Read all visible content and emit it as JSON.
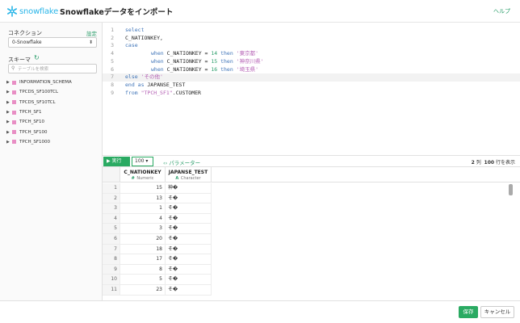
{
  "header": {
    "logo_text": "snowflake",
    "title": "Snowflakeデータをインポート",
    "help_label": "ヘルプ"
  },
  "sidebar": {
    "connection_label": "コネクション",
    "settings_label": "設定",
    "connection_value": "0-Snowflake",
    "schema_label": "スキーマ",
    "search_placeholder": "テーブルを検索",
    "schemas": [
      "INFORMATION_SCHEMA",
      "TPCDS_SF100TCL",
      "TPCDS_SF10TCL",
      "TPCH_SF1",
      "TPCH_SF10",
      "TPCH_SF100",
      "TPCH_SF1000"
    ]
  },
  "editor": {
    "line_numbers": [
      "1",
      "2",
      "3",
      "4",
      "5",
      "6",
      "7",
      "8",
      "9"
    ],
    "lines": {
      "l1": "select",
      "l2": "C_NATIONKEY,",
      "l3": "case",
      "l4_when": "when",
      "l4_col": " C_NATIONKEY = ",
      "l4_num": "14",
      "l4_then": " then ",
      "l4_str": "'東京都'",
      "l5_when": "when",
      "l5_col": " C_NATIONKEY = ",
      "l5_num": "15",
      "l5_then": " then ",
      "l5_str": "'神奈川県'",
      "l6_when": "when",
      "l6_col": " C_NATIONKEY = ",
      "l6_num": "16",
      "l6_then": " then ",
      "l6_str": "'埼玉県'",
      "l7_else": "else ",
      "l7_str": "'その他'",
      "l8_end": "end as",
      "l8_alias": " JAPANSE_TEST",
      "l9_from": "from ",
      "l9_str": "\"TPCH_SF1\"",
      "l9_rest": ".CUSTOMER"
    }
  },
  "toolbar": {
    "run_label": "実行",
    "limit_value": "100",
    "params_label": "パラメーター",
    "columns_count": "2",
    "columns_unit": "列",
    "rows_count": "100",
    "rows_unit": "行を表示"
  },
  "results": {
    "columns": [
      {
        "name": "C_NATIONKEY",
        "type_tag": "#",
        "type": "Numeric"
      },
      {
        "name": "JAPANSE_TEST",
        "type_tag": "A",
        "type": "Character"
      }
    ],
    "rows": [
      {
        "i": "1",
        "key": "15",
        "val": "神�"
      },
      {
        "i": "2",
        "key": "13",
        "val": "そ�"
      },
      {
        "i": "3",
        "key": "1",
        "val": "そ�"
      },
      {
        "i": "4",
        "key": "4",
        "val": "そ�"
      },
      {
        "i": "5",
        "key": "3",
        "val": "そ�"
      },
      {
        "i": "6",
        "key": "20",
        "val": "そ�"
      },
      {
        "i": "7",
        "key": "18",
        "val": "そ�"
      },
      {
        "i": "8",
        "key": "17",
        "val": "そ�"
      },
      {
        "i": "9",
        "key": "8",
        "val": "そ�"
      },
      {
        "i": "10",
        "key": "5",
        "val": "そ�"
      },
      {
        "i": "11",
        "key": "23",
        "val": "そ�"
      }
    ]
  },
  "footer": {
    "save_label": "保存",
    "cancel_label": "キャンセル"
  },
  "colors": {
    "brand": "#29b5e8",
    "accent": "#2aaa62"
  }
}
